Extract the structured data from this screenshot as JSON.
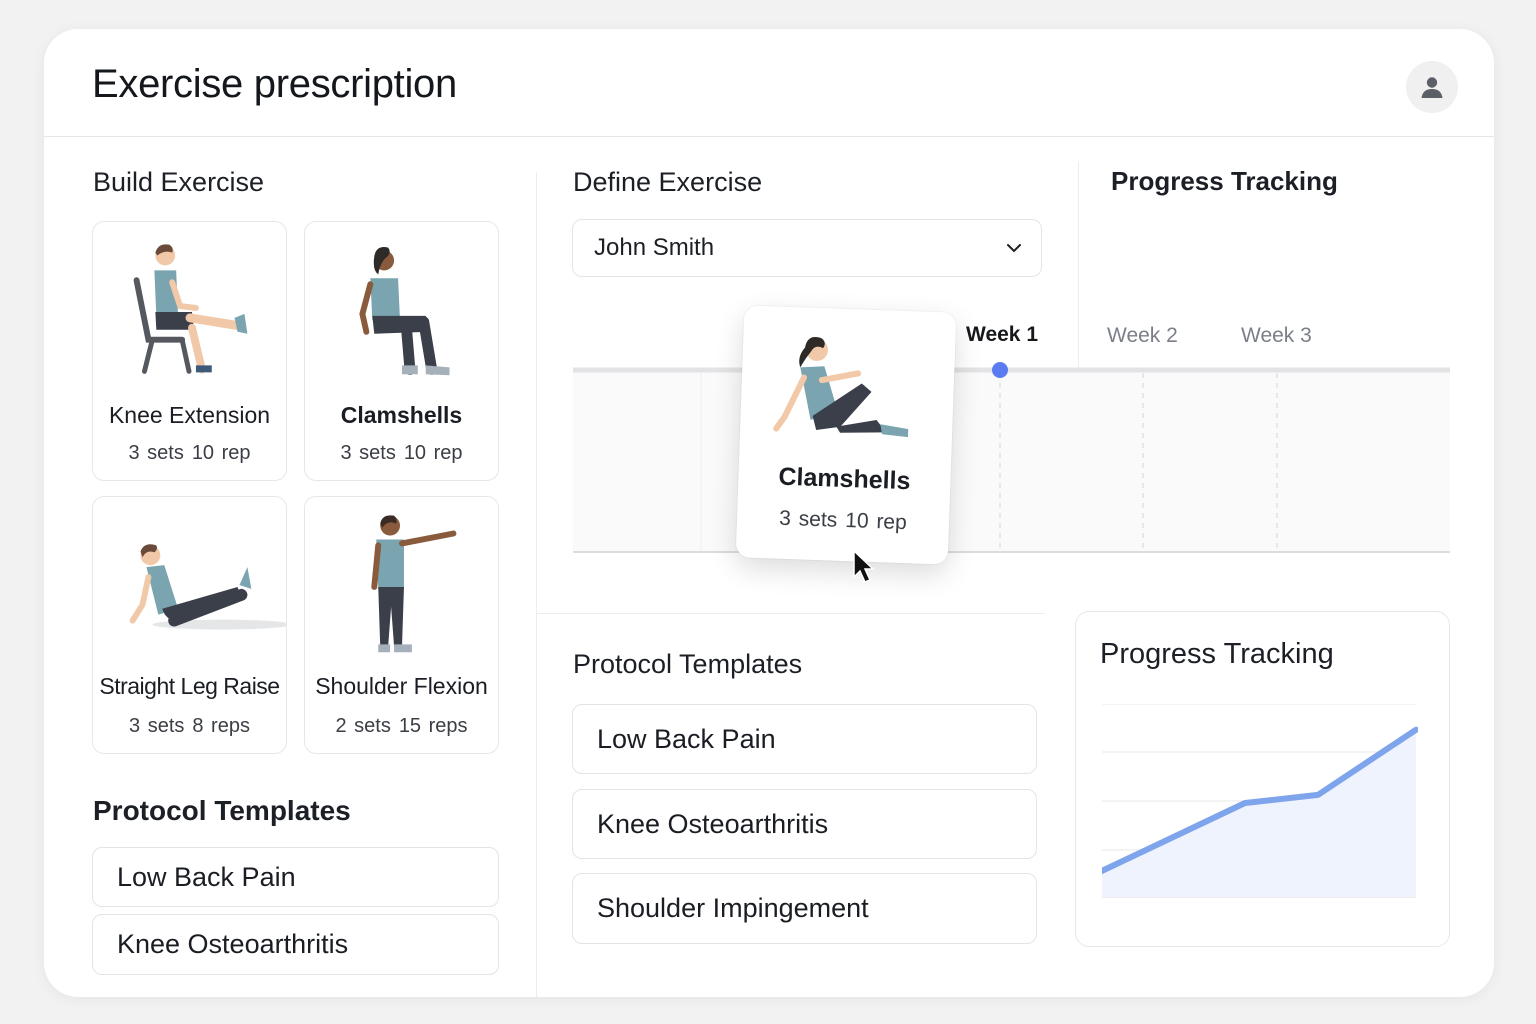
{
  "header": {
    "title": "Exercise prescription",
    "avatar_icon": "user-icon"
  },
  "build": {
    "title": "Build Exercise",
    "exercises": [
      {
        "name": "Knee Extension",
        "sets": "3 sets",
        "reps": "10 rep"
      },
      {
        "name": "Clamshells",
        "sets": "3 sets",
        "reps": "10 rep"
      },
      {
        "name": "Straight Leg Raise",
        "sets": "3 sets",
        "reps": "8 reps"
      },
      {
        "name": "Shoulder Flexion",
        "sets": "2 sets",
        "reps": "15 reps"
      }
    ]
  },
  "left_protocols": {
    "title": "Protocol Templates",
    "items": [
      "Low Back Pain",
      "Knee Osteoarthritis"
    ]
  },
  "define": {
    "title": "Define Exercise",
    "patient_select": "John Smith",
    "weeks": [
      "Week 1",
      "Week 2",
      "Week 3"
    ],
    "active_week": "Week 1",
    "dragging_card": {
      "name": "Clamshells",
      "sets": "3 sets",
      "reps": "10 rep"
    }
  },
  "progress_top": {
    "title": "Progress Tracking"
  },
  "mid_protocols": {
    "title": "Protocol Templates",
    "items": [
      "Low Back Pain",
      "Knee Osteoarthritis",
      "Shoulder Impingement"
    ]
  },
  "progress_chart": {
    "title": "Progress Tracking"
  },
  "colors": {
    "accent": "#5b7cf0",
    "line": "#7ea4ec",
    "fill": "#eef3fd",
    "shirt": "#7aa5b0",
    "pants": "#3b3f4a",
    "skin": "#f1c8a8"
  },
  "chart_data": {
    "type": "area",
    "x": [
      0,
      1,
      2,
      3,
      4
    ],
    "series": [
      {
        "values": [
          1.0,
          3.5,
          3.8,
          6.2
        ]
      }
    ],
    "grid": true,
    "legend": "none"
  }
}
